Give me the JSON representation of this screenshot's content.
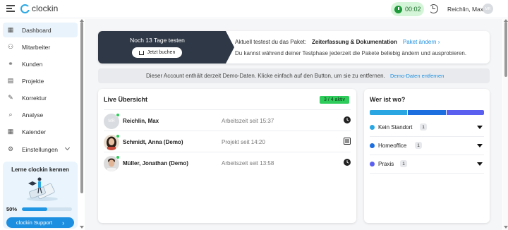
{
  "topbar": {
    "logo_text": "clockin",
    "timer": "00:02",
    "user_name": "Reichlin, Max",
    "avatar_initials": "MR"
  },
  "sidebar": {
    "items": [
      {
        "label": "Dashboard",
        "icon": "dashboard-icon",
        "glyph": "▦",
        "active": true
      },
      {
        "label": "Mitarbeiter",
        "icon": "team-icon",
        "glyph": "⚇"
      },
      {
        "label": "Kunden",
        "icon": "handshake-icon",
        "glyph": "⚭"
      },
      {
        "label": "Projekte",
        "icon": "projects-icon",
        "glyph": "▤"
      },
      {
        "label": "Korrektur",
        "icon": "edit-icon",
        "glyph": "✎"
      },
      {
        "label": "Analyse",
        "icon": "analysis-icon",
        "glyph": "⌕"
      },
      {
        "label": "Kalender",
        "icon": "calendar-icon",
        "glyph": "▦"
      },
      {
        "label": "Einstellungen",
        "icon": "gear-icon",
        "glyph": "⚙"
      }
    ],
    "learn": {
      "title": "Lerne clockin kennen",
      "progress_label": "50%",
      "progress": 0.5,
      "support_label": "clockin Support"
    }
  },
  "trial": {
    "title": "Noch 13 Tage testen",
    "buy_label": "Jetzt buchen",
    "current_package_label": "Aktuell testest du das Paket:",
    "package_name": "Zeiterfassung & Dokumentation",
    "change_link": "Paket ändern",
    "info": "Du kannst während deiner Testphase jederzeit die Pakete beliebig ändern und ausprobieren."
  },
  "demo": {
    "text": "Dieser Account enthält derzeit Demo-Daten. Klicke einfach auf den Button, um sie zu entfernen.",
    "link": "Demo-Daten entfernen"
  },
  "live": {
    "title": "Live Übersicht",
    "badge": "3 / 4 aktiv",
    "rows": [
      {
        "name": "Reichlin, Max",
        "status": "Arbeitszeit seit 15:37",
        "initials": "MR",
        "icon": "clock-icon"
      },
      {
        "name": "Schmidt, Anna (Demo)",
        "status": "Projekt seit 14:20",
        "initials": "",
        "icon": "project-list-icon"
      },
      {
        "name": "Müller, Jonathan (Demo)",
        "status": "Arbeitszeit seit 13:58",
        "initials": "",
        "icon": "clock-icon"
      }
    ]
  },
  "where": {
    "title": "Wer ist wo?",
    "locations": [
      {
        "name": "Kein Standort",
        "count": "1",
        "color": "#2aa7e3"
      },
      {
        "name": "Homeoffice",
        "count": "1",
        "color": "#1d6fe0"
      },
      {
        "name": "Praxis",
        "count": "1",
        "color": "#5b5ff0"
      }
    ]
  },
  "colors": {
    "accent": "#1d8fe0",
    "active_green": "#2ecc5a",
    "dark_panel": "#2f3846"
  }
}
